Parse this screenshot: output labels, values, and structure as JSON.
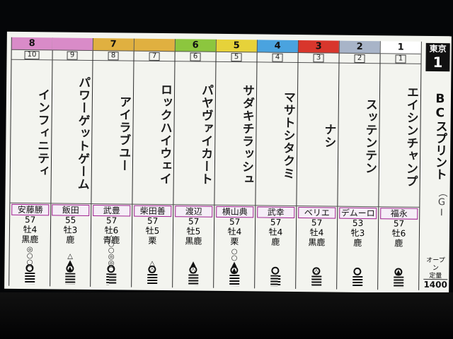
{
  "race": {
    "venue": "東京",
    "number": "1",
    "name": "BCスプリント",
    "grade": "（GⅠ",
    "conditions": "オープン\n定量",
    "distance": "1400"
  },
  "horses": [
    {
      "frame": "8",
      "frame_color": "#d98bc8",
      "num": "10",
      "name": "インフィニティ",
      "jockey": "安藤勝",
      "weight": "57",
      "sexage": "牡4",
      "coat": "黒鹿",
      "marks": [
        "◎",
        "○",
        "○",
        "○"
      ]
    },
    {
      "frame": "",
      "frame_color": "#d98bc8",
      "num": "9",
      "name": "パワーゲットゲーム",
      "jockey": "飯田",
      "weight": "55",
      "sexage": "牡3",
      "coat": "鹿",
      "marks": [
        "△",
        "▲",
        "▲"
      ]
    },
    {
      "frame": "7",
      "frame_color": "#e0b040",
      "num": "8",
      "name": "アイラブユー",
      "jockey": "武豊",
      "weight": "57",
      "sexage": "牡6",
      "coat": "青鹿",
      "marks": [
        "△",
        "○",
        "○",
        "◎",
        "◎",
        "○"
      ]
    },
    {
      "frame": "",
      "frame_color": "#e0b040",
      "num": "7",
      "name": "ロックハイウェイ",
      "jockey": "柴田善",
      "weight": "57",
      "sexage": "牡5",
      "coat": "栗",
      "marks": [
        "△",
        "△"
      ]
    },
    {
      "frame": "6",
      "frame_color": "#8cc63e",
      "num": "6",
      "name": "パヤヴァイカート",
      "jockey": "渡辺",
      "weight": "57",
      "sexage": "牡5",
      "coat": "黒鹿",
      "marks": [
        "▲",
        "△"
      ]
    },
    {
      "frame": "5",
      "frame_color": "#e6d23a",
      "num": "5",
      "name": "サダキチラッシュ",
      "jockey": "横山典",
      "weight": "57",
      "sexage": "牡4",
      "coat": "栗",
      "marks": [
        "○",
        "○",
        "▲",
        "▲"
      ]
    },
    {
      "frame": "4",
      "frame_color": "#4aa3df",
      "num": "4",
      "name": "マサトシタクミ",
      "jockey": "武幸",
      "weight": "57",
      "sexage": "牡4",
      "coat": "鹿",
      "marks": []
    },
    {
      "frame": "3",
      "frame_color": "#d8362c",
      "num": "3",
      "name": "ナシ",
      "jockey": "ベリエ",
      "weight": "57",
      "sexage": "牡4",
      "coat": "黒鹿",
      "marks": [
        "△"
      ]
    },
    {
      "frame": "2",
      "frame_color": "#a8b4c8",
      "num": "2",
      "name": "スッテンテン",
      "jockey": "デムーロ",
      "weight": "53",
      "sexage": "牝3",
      "coat": "鹿",
      "marks": []
    },
    {
      "frame": "1",
      "frame_color": "#ffffff",
      "num": "1",
      "name": "エイシンチャンプ",
      "jockey": "福永",
      "weight": "57",
      "sexage": "牡6",
      "coat": "鹿",
      "marks": [
        "▲"
      ]
    }
  ]
}
